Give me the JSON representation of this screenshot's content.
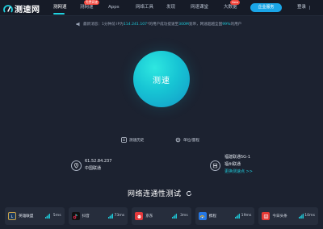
{
  "nav": {
    "logo_text": "测速网",
    "items": [
      {
        "label": "测网速"
      },
      {
        "label": "测网速"
      },
      {
        "label": "Apps"
      },
      {
        "label": "网络工具"
      },
      {
        "label": "发现"
      },
      {
        "label": "网速课堂"
      },
      {
        "label": "大数据"
      }
    ],
    "badges": [
      {
        "label": "免费网速"
      },
      {
        "label": "New"
      }
    ],
    "enterprise_label": "企业服务",
    "login_label": "登录"
  },
  "notice": {
    "prefix": "最新消息：1分钟前 IP为",
    "ip": "114.241.107",
    "middle": "*的用户成功提速至",
    "speed": "300M",
    "middle2": "宽带，网速超越全国",
    "percent": "99%",
    "suffix": "的用户"
  },
  "speed_button": {
    "label": "测速"
  },
  "tools": {
    "history": "测速历史",
    "unit": "单位/量程"
  },
  "client": {
    "ip": "61.52.84.237",
    "isp": "中国联通"
  },
  "server": {
    "name": "福建联通5G-1",
    "location": "福州联通",
    "change_label": "更换测速点 >>"
  },
  "connectivity": {
    "title": "网络连通性测试",
    "sites": [
      {
        "name": "英雄联盟",
        "ms": "5ms",
        "color": "#1d3a5c"
      },
      {
        "name": "抖音",
        "ms": "73ms",
        "color": "#111111"
      },
      {
        "name": "京东",
        "ms": "3ms",
        "color": "#e4393c"
      },
      {
        "name": "携程",
        "ms": "19ms",
        "color": "#2577e3"
      },
      {
        "name": "今日头条",
        "ms": "10ms",
        "color": "#e53935"
      }
    ]
  },
  "colors": {
    "accent": "#1fc8d8",
    "brand_blue": "#1aa6e8",
    "background": "#1c2230"
  }
}
